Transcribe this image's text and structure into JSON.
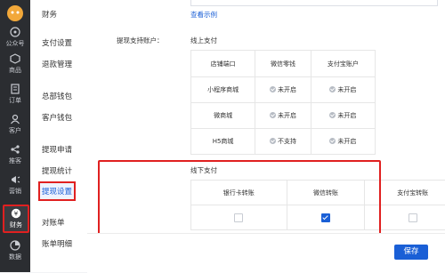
{
  "rail": {
    "items": [
      {
        "label": "公众号",
        "icon": "wechat-icon"
      },
      {
        "label": "商品",
        "icon": "box-icon"
      },
      {
        "label": "订单",
        "icon": "order-icon"
      },
      {
        "label": "客户",
        "icon": "user-icon"
      },
      {
        "label": "推客",
        "icon": "share-icon"
      },
      {
        "label": "营销",
        "icon": "megaphone-icon"
      },
      {
        "label": "财务",
        "icon": "yen-icon"
      },
      {
        "label": "数据",
        "icon": "pie-chart-icon"
      }
    ]
  },
  "subnav": {
    "title": "财务",
    "items": [
      "支付设置",
      "退款管理",
      "总部钱包",
      "客户钱包",
      "提现申请",
      "提现统计",
      "提现设置",
      "对账单",
      "账单明细"
    ]
  },
  "main": {
    "view_example": "查看示例",
    "label": "提现支持账户：",
    "online_title": "线上支付",
    "online_headers": [
      "店铺端口",
      "微信零钱",
      "支付宝账户"
    ],
    "online_rows": [
      {
        "name": "小程序商城",
        "wx": "未开启",
        "ali": "未开启"
      },
      {
        "name": "微商城",
        "wx": "未开启",
        "ali": "未开启"
      },
      {
        "name": "H5商城",
        "wx": "不支持",
        "ali": "未开启"
      }
    ],
    "offline_title": "线下支付",
    "offline_headers": [
      "银行卡转账",
      "微信转账",
      "支付宝转账"
    ],
    "offline_checked": [
      false,
      true,
      false
    ]
  },
  "footer": {
    "save_label": "保存"
  },
  "colors": {
    "accent": "#1a5fd6",
    "highlight": "#e02020",
    "rail": "#2b2d31"
  }
}
